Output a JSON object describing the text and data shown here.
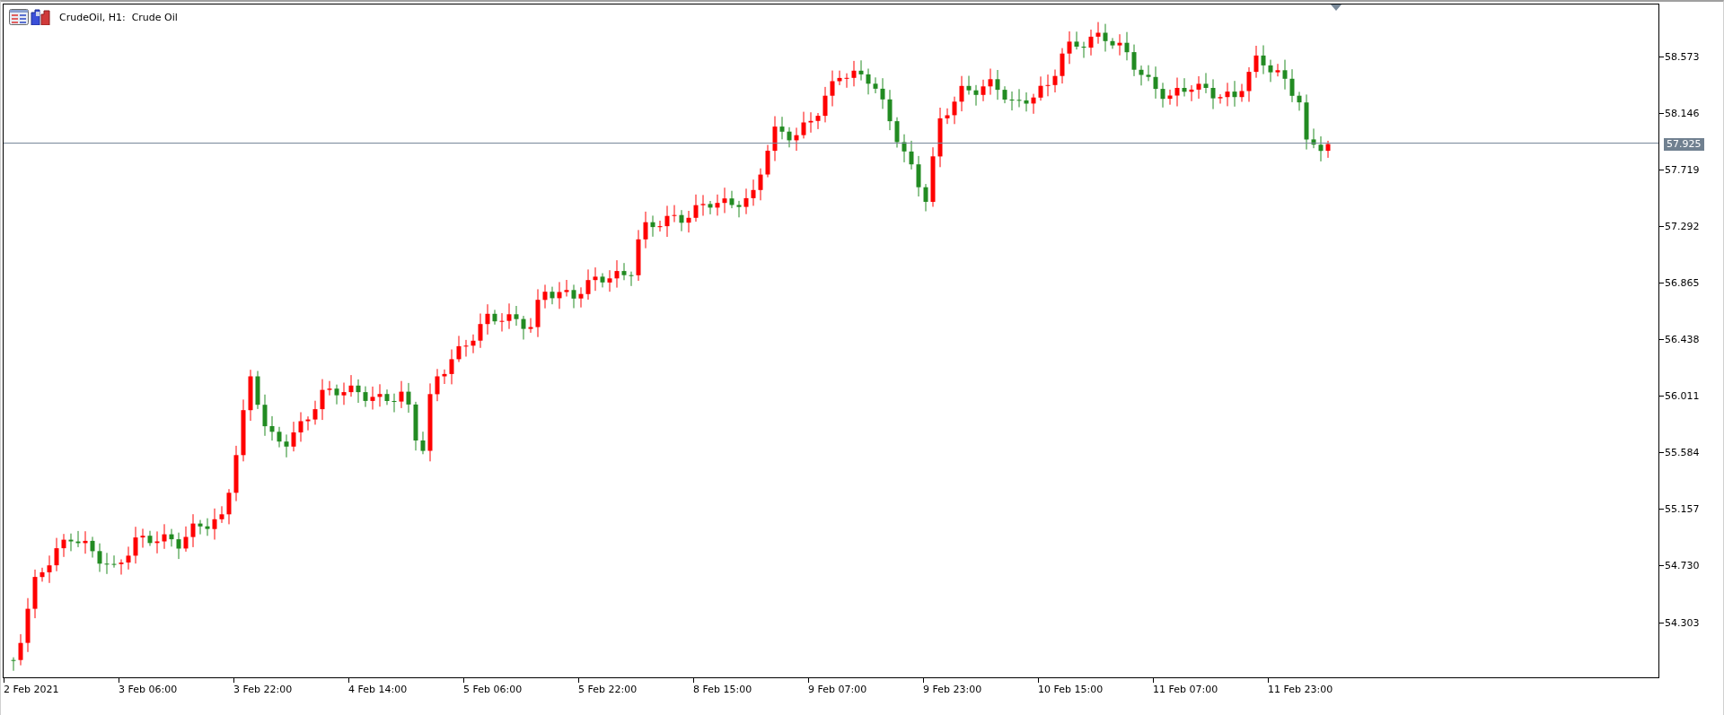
{
  "chart_window": {
    "title": "CrudeOil, H1:  Crude Oil",
    "price_axis": {
      "ticks": [
        "58.573",
        "58.146",
        "57.719",
        "57.292",
        "56.865",
        "56.438",
        "56.011",
        "55.584",
        "55.157",
        "54.730",
        "54.303"
      ],
      "current_price": "57.925"
    },
    "time_axis": {
      "labels": [
        "2 Feb 2021",
        "3 Feb 06:00",
        "3 Feb 22:00",
        "4 Feb 14:00",
        "5 Feb 06:00",
        "5 Feb 22:00",
        "8 Feb 15:00",
        "9 Feb 07:00",
        "9 Feb 23:00",
        "10 Feb 15:00",
        "11 Feb 07:00",
        "11 Feb 23:00"
      ]
    }
  }
}
